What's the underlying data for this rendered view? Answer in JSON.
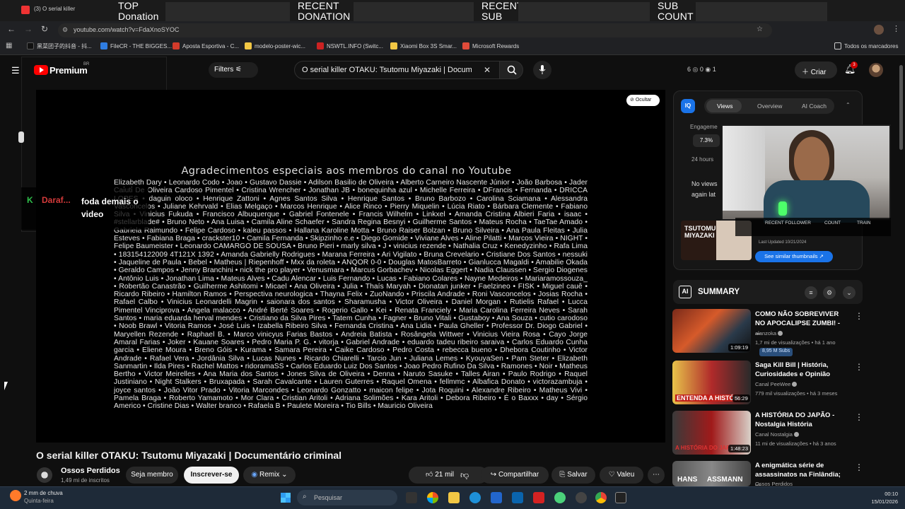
{
  "overlay": {
    "top_donation": "TOP\nDonation",
    "recent_donation": "RECENT\nDONATION",
    "recent_sub": "RECENT\nSUB",
    "sub_count": "SUB\nCOUNT"
  },
  "browser": {
    "tab_title": "(3) O serial killer",
    "url": "youtube.com/watch?v=FdaXnoSYOC",
    "bookmarks": [
      {
        "label": "黑菜团子的抖音 - 抖...",
        "color": "#111111"
      },
      {
        "label": "FileCR - THE BIGGES...",
        "color": "#2f7de1"
      },
      {
        "label": "Aposta Esportiva - C...",
        "color": "#d23b2b"
      },
      {
        "label": "modelo-poster-wic...",
        "color": "#f2c744"
      },
      {
        "label": "NSWTL.INFO (Switc...",
        "color": "#cc2222"
      },
      {
        "label": "Xiaomi Box 3S Smar...",
        "color": "#f2c744"
      },
      {
        "label": "Microsoft Rewards",
        "color": "#e04b3a"
      }
    ],
    "all_bookmarks": "Todos os marcadores"
  },
  "youtube": {
    "logo_text": "Premium",
    "logo_region": "BR",
    "filters_label": "Filters",
    "search_value": "O serial killer OTAKU: Tsutomu Miyazaki | Docume",
    "stats": "6  ◎ 0  ◉ 1",
    "create_label": "Criar",
    "notif_count": "3"
  },
  "player": {
    "hide_label": "Ocultar",
    "credits_title": "Agradecimentos especiais aos membros do canal no Youtube",
    "credits_text": "Elizabeth Dary • Leonardo Codo • Joao • Gustavo Dassie • Adilson Basilio de Oliveira • Alberto Carneiro Nascente Júnior • João Barbosa • Jader Caiuti De Oliveira Cardoso Pimentel • Cristina Wrencher • Jonathan JB • bonequinha azul • Michelle Ferreira • DFrancis • Fernanda • DRICCA LOPES • daguin oloco • Henrique Zattoni • Agnes Santos Silva • Henrique Santos • Bruno Barbozo • Carolina Sciamana • Alessandra Vasconcelos • Juliane Kehrvald • Elias Melgaço • Marcos Henrique • Alice Rinco • Pierry Miquelin • Lúcia Riato • Bárbara Clemente • Fabiano Silva • Vinicius Fukuda • Francisco Albuquerque • Gabriel Fontenele • Francis Wilhelm • Linkxel • Amanda Cristina Albieri Faria • isaac • #stellarblade# • Bruno Neto • Ana Luisa • Camila Aline Schaefer • Sandra Regina Besnyi • Guilherme Santos • Mateus Rocha • TaeTae Amado • Gabriela Raimundo • Felipe Cardoso • kaleu passos • Hallana Karoline Motta • Bruno Raiser Bolzan • Bruno Silveira • Ana Paula Fleitas • Julia Esteves • Fabiana Braga • crackster10 • Camila Fernanda • Skipzinho e.e • Diego Gomide • Viviane Alves • Aline Pilatti • Marcos Vieira • NIGHT • Felipe Baumeister • Leonardo CAMARGO DE SOUSA • Bruno Pieri • marly silva • J • vinicius rezende • Nathalia Cruz • Kenedyzinho • Rafa Lima • 183154122009 4T121X 1392 • Amanda Gabrielly Rodrigues • Marana Ferreira • Ari Vigilato • Bruna Crevelario • Cristiane Dos Santos • nessuki • Jaqueline de Paula • Bebel • Matheus | Riepenhoff • Mxx da roleta • ANQOR 0-0 • Douglas MatosBarreto • Gianlucca Magaldi • Amabilie Okada • Geraldo Campos • Jenny Branchini • nick the pro player • Venusmara • Marcus Gorbachev • Nicolas Eggert • Nadia Claussen • Sergio Diogenes • Antônio Luis • Jonathan Lima • Mateus Alves • Cadu Alencar • Luis Fernando • Lucas • Fabiano Colares • Nayne Medeiros • Mariaramossouza_ • Robertão Canastrão • Guilherme Ashitomi • Micael • Ana Oliveira • Julia • Thaís Maryah • Dionatan junker • Faelzineo • FISK • Miguel cauê • Ricardo Ribeiro • Hamilton Ramos • Perspectiva neurologica • Thayna Felix • ZuoNando • Priscila Andrade • Roni Vasconcelos • Josias Rocha • Rafael Calbo • Vinicius Leonardelli Magrin • saionara dos santos • Sharamusha • Victor Oliveira • Daniel Morgan • Rutielis Rafael • Lucca Pimentel Vinciprova • Angela malacco • André Berté Soares • Rogerio Gallo • Kei • Renata Franciely • Maria Carolina Ferreira Neves • Sarah Santos • maria eduarda herval mendes • Cristiano da Silva Pires • Tatem Cunha • Fagner • Bruno Vitali • Gustaboy • Ana Souza • cutio carodoso • Noob Brawl • Vitoria Ramos • José Luis • Izabella Ribeiro Silva • Fernanda Cristina • Ana Lidia • Paula Gheller • Professor Dr. Diogo Gabriel • Maryellen Rezende • Raphael B. • Marco vinicyus Farias Bastos • Andreia Batista • Rosângela Wittwer • Vinicius Vieira Rosa • Cayo Jorge Amaral Farias • Joker • Kauane Soares • Pedro Maria P. G. • vitorja • Gabriel Andrade • eduardo tadeu ribeiro saraiva • Carlos Eduardo Cunha garcia • Eliene Moura • Breno Góis • Kurama • Samara Pereira • Caike Cardoso • Pedro Costa • rebecca bueno • Dhebora Coutinho • Victor Andrade • Rafael Vera • Jordânia Silva • Lucas Nunes • Ricardo Chiarelli • Tarcio Jun • Juliana Lemes • KyouyaSen • Pam Steter • Elizabeth Sanmartin • Ilda Pires • Rachel Mattos • ridoramaSS • Carlos Eduardo Luiz Dos Santos • Joao Pedro Rufino Da Silva • Ramones • Noir • Matheus Bertho • Victor Meirelles • Ana Maria dos Santos • Jones Silva de Oliveira • Denna • Naruto Sasuke • Talles Airan • Paulo Rodrigo • Raquel Justiniano • Night Stalkers • Bruxapada • Sarah Cavalcante • Lauren Guterres • Raquel Omena • fellmmc • Albafica Donato • victorazambuja • joyce santos • João Vitor Prado • Vitoria Marcondes • Leonardo Gonzatto • maicon felipe • Jota Roquini • Alexandre Ribeiro • Matheus Vivi • Pamela Braga • Roberto Yamamoto • Mor Clara • Cristian Aritoli • Adriana Solimões • Kara Aritoli • Debora Ribeiro • É o Baxxx • day • Sérgio Americo • Cristine Dias • Walter branco • Rafaela B • Paulete Moreira • Tio Bills • Mauricio Oliveira",
    "chat_k": "K",
    "chat_user": "Daraf...",
    "chat_msg": "foda demais o video"
  },
  "video": {
    "title": "O serial killer OTAKU: Tsutomu Miyazaki | Documentário criminal",
    "channel": "Ossos Perdidos",
    "subs": "1,49 mi de inscritos",
    "join": "Seja membro",
    "subscribe": "Inscrever-se",
    "remix": "Remix",
    "likes": "21 mil",
    "share": "Compartilhar",
    "save": "Salvar",
    "thanks": "Valeu"
  },
  "vidiq": {
    "logo": "IQ",
    "tabs": [
      "Views",
      "Overview",
      "AI Coach"
    ],
    "engagement_label": "Engageme",
    "engagement_value": "7.3%",
    "hours_label": "24 hours",
    "no_views": "No views\nagain lat",
    "thumb_text": "TSUTOMU\nMIYAZAKI",
    "last_updated": "Last Updated 10/21/2024",
    "similar_btn": "See similar thumbnails ↗"
  },
  "webcam": {
    "labels": [
      "RECENT FOLLOWER",
      "COUNT",
      "TRAIN"
    ]
  },
  "summary": {
    "ai_icon": "AI",
    "label": "SUMMARY"
  },
  "recommendations": [
    {
      "title": "COMO NÃO SOBREVIVER NO APOCALIPSE ZUMBI! - ...",
      "channel": "alanzoka",
      "views": "1,7 mi de visualizações • há 1 ano",
      "subs_chip": "8,95 M Subs",
      "duration": "1:09:19",
      "thumb_text": ""
    },
    {
      "title": "Saga Kill Bill | História, Curiosidades e Opinião",
      "channel": "Canal PeeWee",
      "views": "779 mil visualizações • há 3 meses",
      "duration": "56:29",
      "thumb_text": "ENTENDA A HISTÓR"
    },
    {
      "title": "A HISTÓRIA DO JAPÃO - Nostalgia História",
      "channel": "Canal Nostalgia",
      "views": "11 mi de visualizações • há 3 anos",
      "duration": "1:48:23",
      "thumb_text": "A HISTÓRIA DO JAP"
    },
    {
      "title": "A enigmática série de assassinatos na Finlândia; ...",
      "channel": "Ossos Perdidos",
      "views": "",
      "duration": "",
      "thumb_text": "HANS     ASSMANN"
    }
  ],
  "taskbar": {
    "weather_temp": "2 mm de chuva",
    "weather_day": "Quinta-feira",
    "search_placeholder": "Pesquisar",
    "time": "00:10",
    "date": "15/01/2026"
  }
}
